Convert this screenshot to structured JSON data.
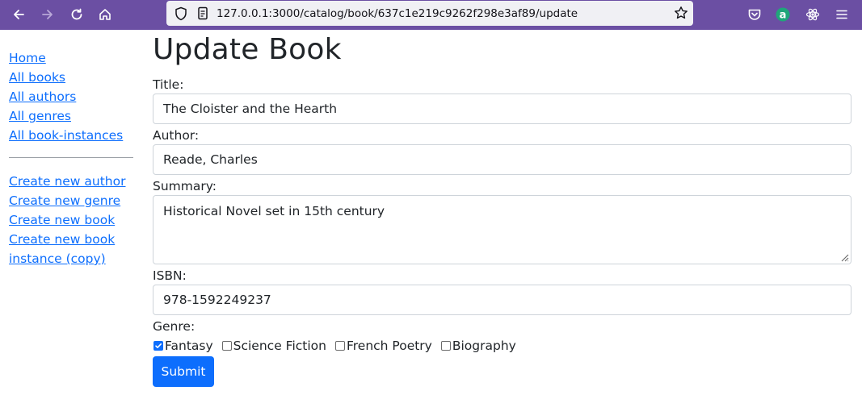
{
  "browser": {
    "url_host": "127.0.0.1",
    "url_path": ":3000/catalog/book/637c1e219c9262f298e3af89/update",
    "colors": {
      "toolbar": "#6b4fa3",
      "urlbar": "#f0f0f4"
    },
    "icons": [
      "back-arrow-icon",
      "forward-arrow-icon",
      "reload-icon",
      "home-icon",
      "shield-icon",
      "page-info-icon",
      "bookmark-star-icon",
      "pocket-icon",
      "extension-a-icon",
      "react-devtools-icon",
      "menu-icon"
    ]
  },
  "sidebar": {
    "links": [
      "Home",
      "All books",
      "All authors",
      "All genres",
      "All book-instances"
    ],
    "create_links": [
      "Create new author",
      "Create new genre",
      "Create new book",
      "Create new book instance (copy)"
    ]
  },
  "form": {
    "title": "Update Book",
    "title_label": "Title:",
    "title_value": "The Cloister and the Hearth",
    "author_label": "Author:",
    "author_value": "Reade, Charles",
    "summary_label": "Summary:",
    "summary_value": "Historical Novel set in 15th century",
    "isbn_label": "ISBN:",
    "isbn_value": "978-1592249237",
    "genre_label": "Genre:",
    "genres": [
      {
        "label": "Fantasy",
        "checked": true
      },
      {
        "label": "Science Fiction",
        "checked": false
      },
      {
        "label": "French Poetry",
        "checked": false
      },
      {
        "label": "Biography",
        "checked": false
      }
    ],
    "submit_label": "Submit",
    "colors": {
      "primary": "#0d6efd",
      "link": "#0d6efd"
    }
  }
}
